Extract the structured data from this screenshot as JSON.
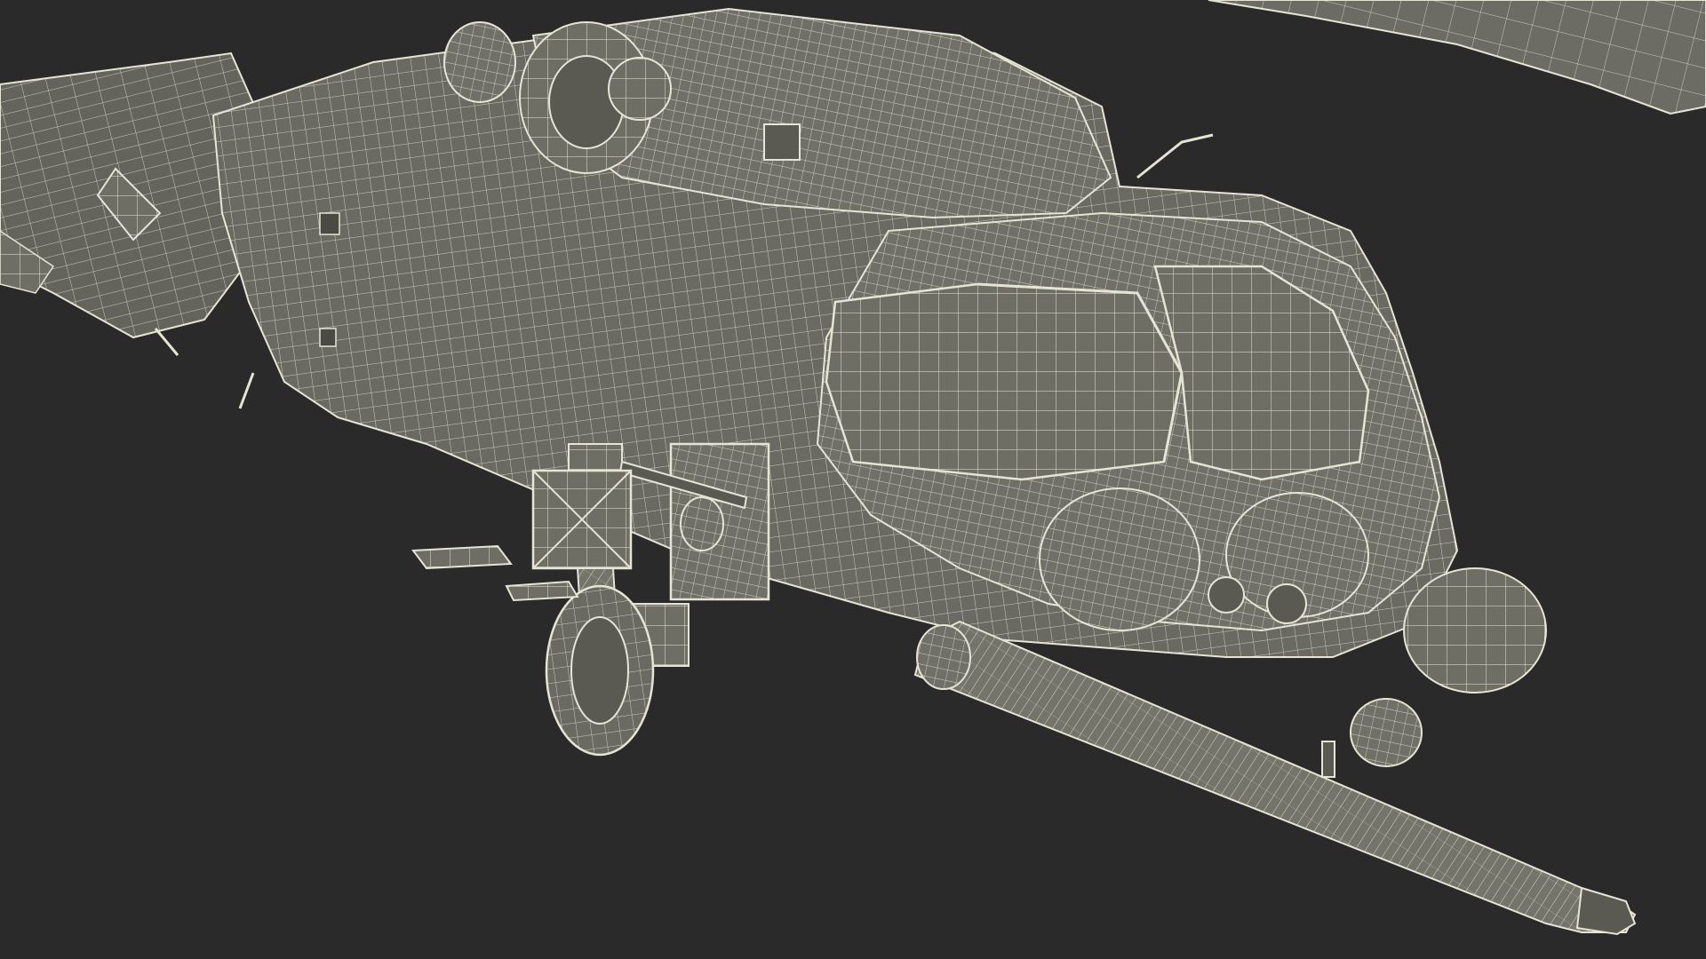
{
  "scene": {
    "background_color": "#2a2a2a",
    "surface_color": "#6e6e65",
    "surface_shadow_color": "#5a5a53",
    "wire_color": "#e6e4d4",
    "subject": "wireframe-helicopter-render"
  }
}
